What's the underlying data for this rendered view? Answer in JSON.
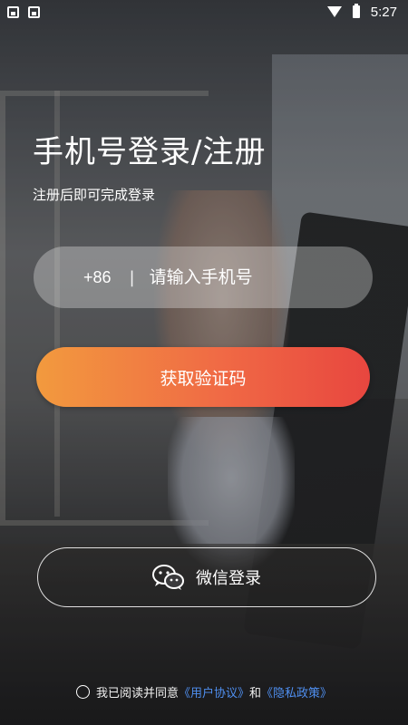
{
  "status_bar": {
    "time": "5:27",
    "icons": [
      "image-icon",
      "app-icon",
      "wifi-icon",
      "battery-icon"
    ]
  },
  "login": {
    "title": "手机号登录/注册",
    "subtitle": "注册后即可完成登录",
    "country_code": "+86",
    "divider": "|",
    "phone_placeholder": "请输入手机号",
    "get_code_label": "获取验证码",
    "wechat_label": "微信登录",
    "agreement_prefix": "我已阅读并同意",
    "user_agreement": "《用户协议》",
    "and": "和",
    "privacy_policy": "《隐私政策》"
  },
  "colors": {
    "button_gradient_start": "#f29a3e",
    "button_gradient_end": "#e8463f",
    "link": "#4f8ff0"
  }
}
